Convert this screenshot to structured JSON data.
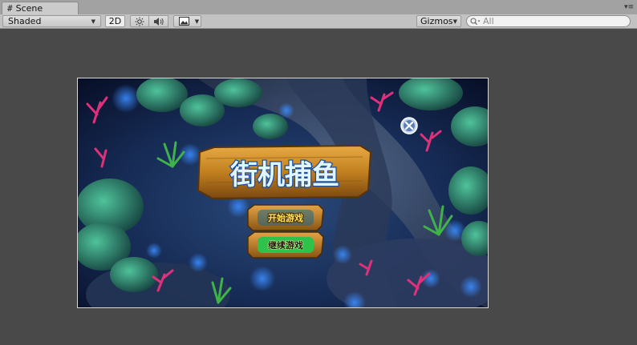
{
  "tab": {
    "icon": "grid-hash-icon",
    "label": "Scene",
    "menu_icon": "tab-menu-icon"
  },
  "toolbar": {
    "shading_mode": "Shaded",
    "mode_2d": "2D",
    "lighting_icon": "sun-icon",
    "audio_icon": "speaker-icon",
    "effects_icon": "image-icon",
    "gizmos_label": "Gizmos",
    "search_placeholder": "All",
    "search_icon": "search-icon"
  },
  "game": {
    "title": "街机捕鱼",
    "start_button": "开始游戏",
    "continue_button": "继续游戏",
    "close_icon": "close-icon",
    "colors": {
      "ocean_deep": "#0b1636",
      "rock": "#3a4a68",
      "wood": "#c98b2d",
      "title_text": "#dff6ff",
      "start_text": "#ffe45a",
      "continue_text": "#1c1405",
      "continue_fill": "#2ec24a",
      "coral": "#e0307a",
      "weed": "#2f9a3a"
    }
  }
}
